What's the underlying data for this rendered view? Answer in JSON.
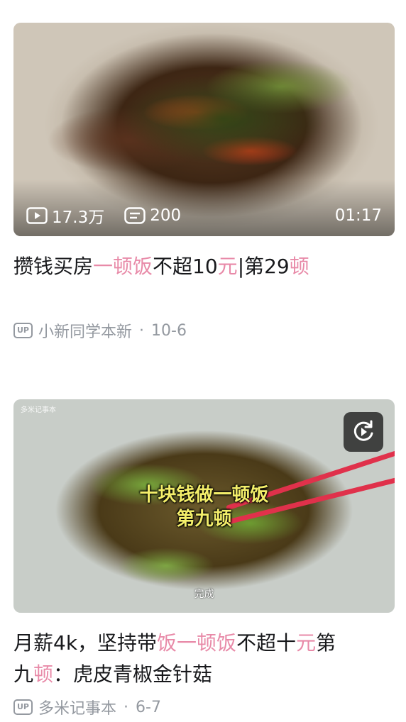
{
  "feed": [
    {
      "views": "17.3万",
      "comments": "200",
      "duration": "01:17",
      "title_parts": [
        {
          "text": "攒钱买房",
          "hl": false
        },
        {
          "text": "一顿饭",
          "hl": true
        },
        {
          "text": "不超10",
          "hl": false
        },
        {
          "text": "元",
          "hl": true
        },
        {
          "text": "|第29",
          "hl": false
        },
        {
          "text": "顿",
          "hl": true
        }
      ],
      "up_badge": "UP",
      "author": "小新同学本新",
      "date": "10-6"
    },
    {
      "caption_line1": "十块钱做一顿饭",
      "caption_line2": "第九顿",
      "caption_small": "完成",
      "watermark": "多米记事本",
      "replay_icon": "replay-icon",
      "title_parts": [
        {
          "text": "月薪4k，坚持带",
          "hl": false
        },
        {
          "text": "饭一顿饭",
          "hl": true
        },
        {
          "text": "不超十",
          "hl": false
        },
        {
          "text": "元",
          "hl": true
        },
        {
          "text": "第",
          "hl": false
        },
        {
          "text": "九",
          "hl": false
        },
        {
          "text": "顿",
          "hl": true
        },
        {
          "text": "：虎皮青椒金针菇",
          "hl": false
        }
      ],
      "up_badge": "UP",
      "author": "多米记事本",
      "date": "6-7"
    }
  ],
  "colors": {
    "highlight": "#e88aa8",
    "text": "#18191c",
    "meta": "#9499a0"
  }
}
